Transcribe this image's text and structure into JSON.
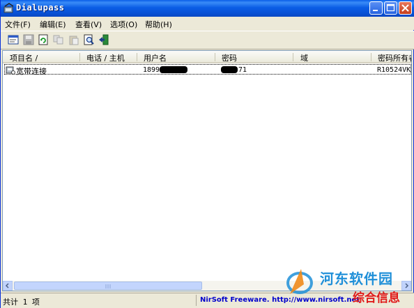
{
  "window": {
    "title": "Dialupass"
  },
  "menu": [
    {
      "label": "文件(F)"
    },
    {
      "label": "编辑(E)"
    },
    {
      "label": "查看(V)"
    },
    {
      "label": "选项(O)"
    },
    {
      "label": "帮助(H)"
    }
  ],
  "toolbar": {
    "icons": [
      "properties-icon",
      "save-icon",
      "refresh-icon",
      "copy-icon",
      "paste-icon",
      "find-icon",
      "exit-icon"
    ]
  },
  "columns": [
    {
      "label": "项目名 /"
    },
    {
      "label": "电话 / 主机"
    },
    {
      "label": "用户名"
    },
    {
      "label": "密码"
    },
    {
      "label": "域"
    },
    {
      "label": "密码所有者"
    }
  ],
  "rows": [
    {
      "name": "宽带连接",
      "phone": "",
      "username": "1899",
      "password": "71",
      "domain": "",
      "owner": "R10524VKI:"
    }
  ],
  "status": {
    "count": "共计 1 项",
    "link": "NirSoft Freeware.  http://www.nirsoft.net"
  },
  "watermark": {
    "line1": "河东软件园",
    "line2": "综合信息"
  },
  "colors": {
    "titlebar": "#0a5ee8",
    "close_button": "#d9522f",
    "link": "#0000cc"
  }
}
